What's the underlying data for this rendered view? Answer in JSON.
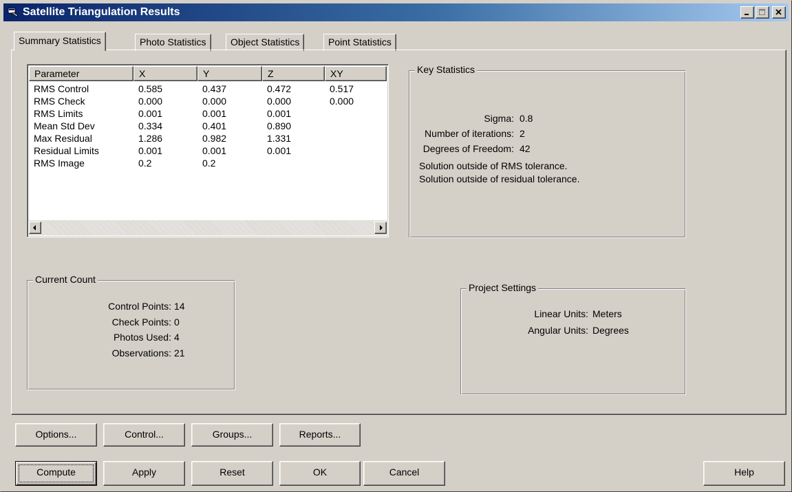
{
  "window": {
    "title": "Satellite Triangulation Results",
    "accent": "#0a246a",
    "face_color": "#d4d0c8"
  },
  "tabs": [
    {
      "label": "Summary Statistics",
      "selected": true
    },
    {
      "label": "Photo Statistics",
      "selected": false
    },
    {
      "label": "Object Statistics",
      "selected": false
    },
    {
      "label": "Point Statistics",
      "selected": false
    }
  ],
  "table": {
    "columns": [
      "Parameter",
      "X",
      "Y",
      "Z",
      "XY"
    ],
    "rows": [
      [
        "RMS Control",
        "0.585",
        "0.437",
        "0.472",
        "0.517"
      ],
      [
        "RMS Check",
        "0.000",
        "0.000",
        "0.000",
        "0.000"
      ],
      [
        "RMS Limits",
        "0.001",
        "0.001",
        "0.001",
        ""
      ],
      [
        "Mean Std Dev",
        "0.334",
        "0.401",
        "0.890",
        ""
      ],
      [
        "Max Residual",
        "1.286",
        "0.982",
        "1.331",
        ""
      ],
      [
        "Residual Limits",
        "0.001",
        "0.001",
        "0.001",
        ""
      ],
      [
        "RMS Image",
        "0.2",
        "0.2",
        "",
        ""
      ]
    ]
  },
  "key_statistics": {
    "title": "Key Statistics",
    "items": [
      {
        "label": "Sigma:",
        "value": "0.8"
      },
      {
        "label": "Number of iterations:",
        "value": "2"
      },
      {
        "label": "Degrees of Freedom:",
        "value": "42"
      }
    ],
    "messages": [
      "Solution outside of RMS tolerance.",
      "Solution outside of residual tolerance."
    ]
  },
  "current_count": {
    "title": "Current Count",
    "items": [
      {
        "label": "Control Points:",
        "value": "14"
      },
      {
        "label": "Check Points:",
        "value": "0"
      },
      {
        "label": "Photos Used:",
        "value": "4"
      },
      {
        "label": "Observations:",
        "value": "21"
      }
    ]
  },
  "project_settings": {
    "title": "Project Settings",
    "items": [
      {
        "label": "Linear Units:",
        "value": "Meters"
      },
      {
        "label": "Angular Units:",
        "value": "Degrees"
      }
    ]
  },
  "buttons": {
    "options": "Options...",
    "control": "Control...",
    "groups": "Groups...",
    "reports": "Reports...",
    "compute": "Compute",
    "apply": "Apply",
    "reset": "Reset",
    "ok": "OK",
    "cancel": "Cancel",
    "help": "Help"
  }
}
